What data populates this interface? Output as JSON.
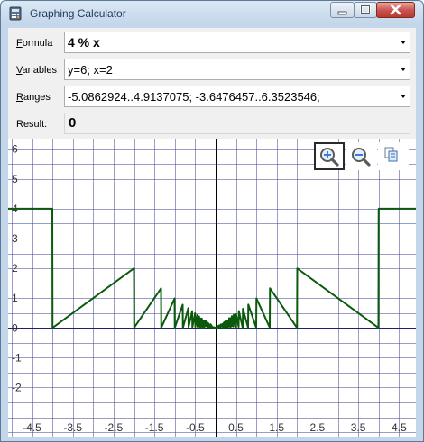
{
  "window": {
    "title": "Graphing Calculator"
  },
  "form": {
    "formula": {
      "accel": "F",
      "rest": "ormula",
      "value": "4 % x"
    },
    "variables": {
      "accel": "V",
      "rest": "ariables",
      "value": "y=6; x=2"
    },
    "ranges": {
      "accel": "R",
      "rest": "anges",
      "value": "-5.0862924..4.9137075; -3.6476457..6.3523546;"
    },
    "result": {
      "label": "Result:",
      "value": "0"
    }
  },
  "toolbar": {
    "zoom_in_icon": "zoom-in-icon",
    "zoom_out_icon": "zoom-out-icon",
    "copy_icon": "copy-icon"
  },
  "colors": {
    "curve": "#0b5a0b",
    "grid": "#4a4a9a",
    "axis": "#000000",
    "accent_zoom": "#3b7bd8"
  },
  "chart_data": {
    "type": "line",
    "title": "",
    "xlabel": "",
    "ylabel": "",
    "xlim": [
      -5.0862924,
      4.9137075
    ],
    "ylim": [
      -3.6476457,
      6.3523546
    ],
    "x_ticks": [
      "-4.5",
      "-3.5",
      "-2.5",
      "-1.5",
      "-0.5",
      "0.5",
      "1.5",
      "2.5",
      "3.5",
      "4.5"
    ],
    "x_tick_values": [
      -4.5,
      -3.5,
      -2.5,
      -1.5,
      -0.5,
      0.5,
      1.5,
      2.5,
      3.5,
      4.5
    ],
    "y_ticks": [
      "-2",
      "-1",
      "0",
      "1",
      "2",
      "3",
      "4",
      "5",
      "6"
    ],
    "y_tick_values": [
      -2,
      -1,
      0,
      1,
      2,
      3,
      4,
      5,
      6
    ],
    "grid": true,
    "series": [
      {
        "function": "4 % x",
        "x_from": -5.0862924,
        "x_to": 4.9137075
      }
    ]
  }
}
